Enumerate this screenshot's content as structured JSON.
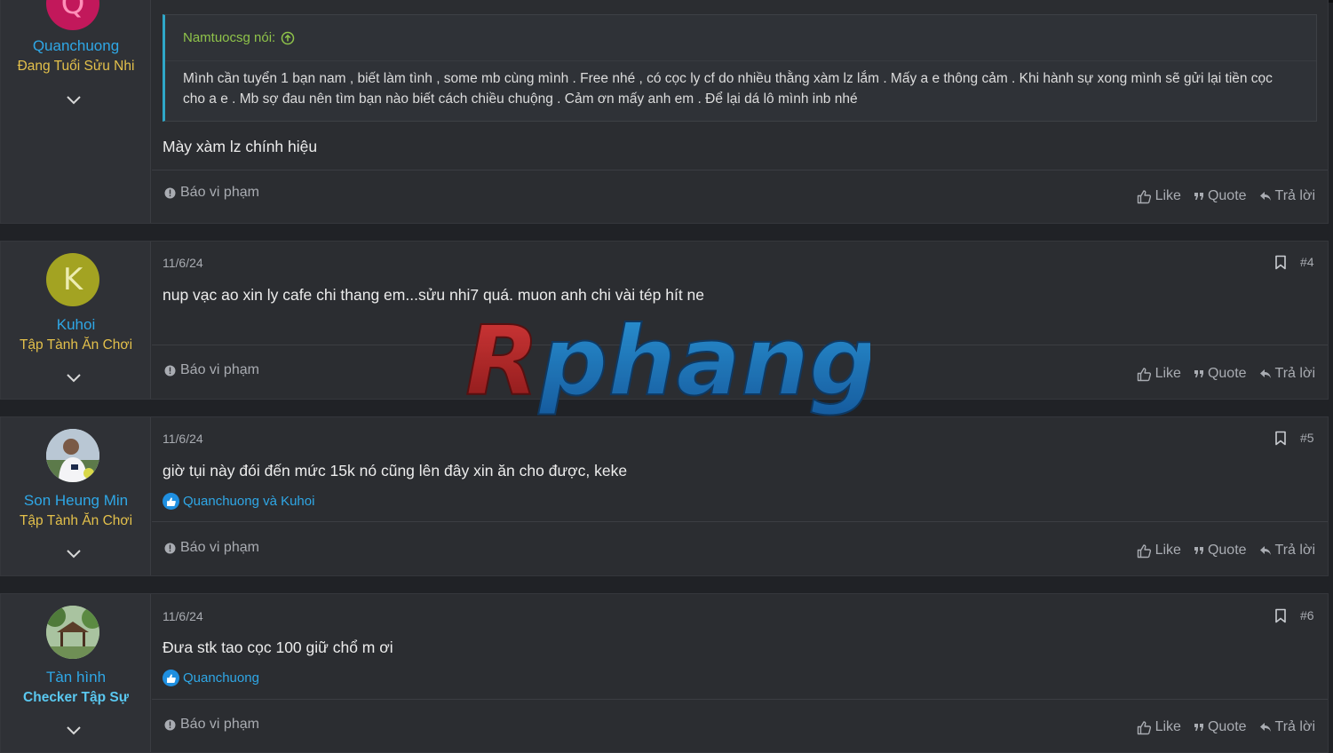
{
  "posts": [
    {
      "username": "Quanchuong",
      "user_title": "Đang Tuổi Sửu Nhi",
      "quote": {
        "author_label": "Namtuocsg nói:",
        "text": "Mình cần tuyển 1 bạn nam , biết làm tình , some mb cùng mình . Free nhé , có cọc ly cf do nhiều thằng xàm lz lắm . Mấy a e thông cảm . Khi hành sự xong mình sẽ gửi lại tiền cọc cho a e . Mb sợ đau nên tìm bạn nào biết cách chiều chuộng . Cảm ơn mấy anh em . Để lại dá lô mình inb nhé"
      },
      "message": "Mày xàm lz chính hiệu"
    },
    {
      "avatar_letter": "K",
      "username": "Kuhoi",
      "user_title": "Tập Tành Ăn Chơi",
      "date": "11/6/24",
      "post_number": "#4",
      "message": "nup vạc ao xin ly cafe chi thang em...sửu nhi7 quá. muon anh chi vài tép hít ne"
    },
    {
      "username": "Son Heung Min",
      "user_title": "Tập Tành Ăn Chơi",
      "date": "11/6/24",
      "post_number": "#5",
      "message": "giờ tụi này đói đến mức 15k nó cũng lên đây xin ăn cho được, keke",
      "reactions": "Quanchuong và Kuhoi"
    },
    {
      "username": "Tàn hình",
      "user_title": "Checker Tập Sự",
      "date": "11/6/24",
      "post_number": "#6",
      "message": "Đưa stk tao cọc 100 giữ chổ m ơi",
      "reactions": "Quanchuong"
    }
  ],
  "labels": {
    "report": "Báo vi phạm",
    "like": "Like",
    "quote": "Quote",
    "reply": "Trả lời"
  },
  "watermark_text": "Rphang",
  "colors": {
    "username": "#2fa7e6",
    "rank_gold": "#e3c04b",
    "rank_checker": "#5ac8f0",
    "quote_author": "#8fc34a"
  }
}
